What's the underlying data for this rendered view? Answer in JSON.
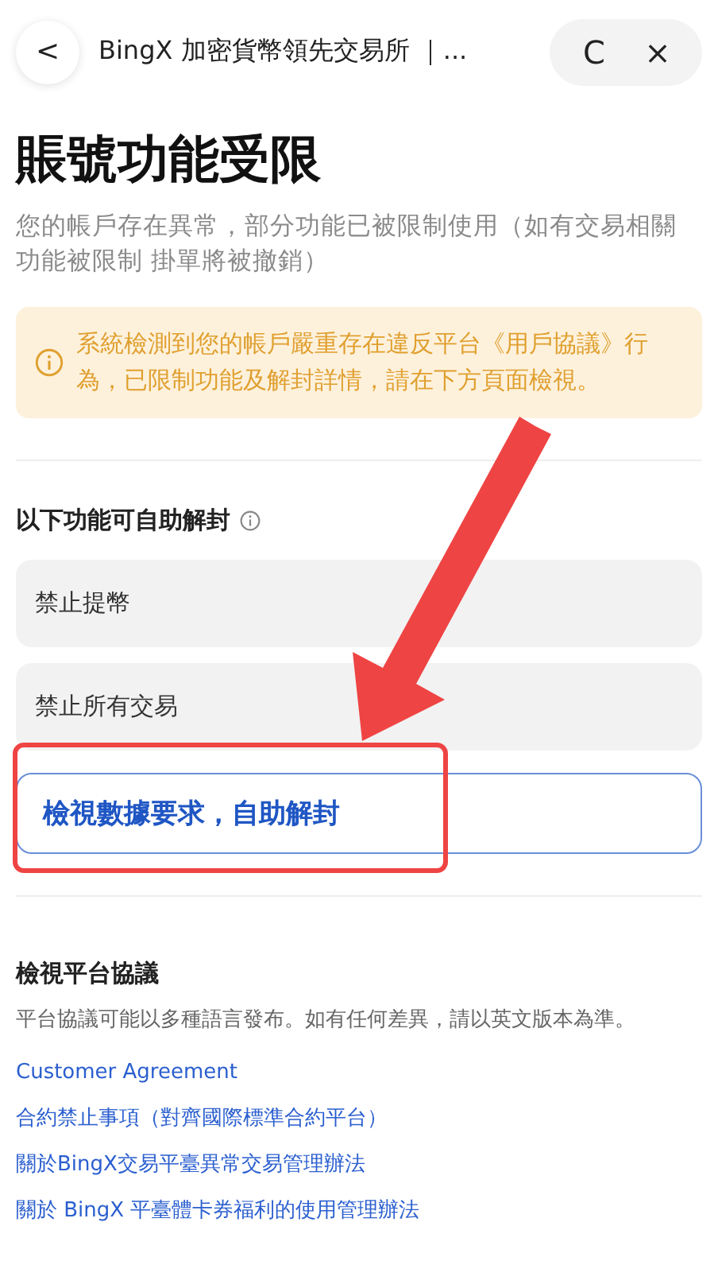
{
  "top_bar": {
    "back": "<",
    "title": "BingX 加密貨幣領先交易所 ｜...",
    "refresh": "C",
    "close": "×"
  },
  "title": "賬號功能受限",
  "subtitle": "您的帳戶存在異常，部分功能已被限制使用（如有交易相關功能被限制 掛單將被撤銷）",
  "warning": {
    "text": "系統檢測到您的帳戶嚴重存在違反平台《用戶協議》行為，已限制功能及解封詳情，請在下方頁面檢視。"
  },
  "self_unlock": {
    "heading": "以下功能可自助解封",
    "items": [
      "禁止提幣",
      "禁止所有交易"
    ],
    "button": "檢視數據要求，自助解封"
  },
  "agreements": {
    "heading": "檢視平台協議",
    "description": "平台協議可能以多種語言發布。如有任何差異，請以英文版本為準。",
    "links": [
      "Customer Agreement",
      "合約禁止事項（對齊國際標準合約平台）",
      "關於BingX交易平臺異常交易管理辦法",
      "關於 BingX 平臺體卡券福利的使用管理辦法"
    ]
  },
  "annotations": {
    "arrow": true,
    "highlight": true
  }
}
